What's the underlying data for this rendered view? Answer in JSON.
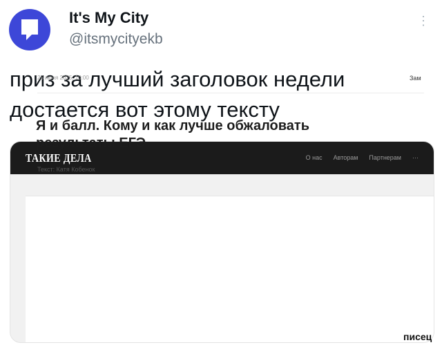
{
  "account": {
    "name": "It's My City",
    "handle": "@itsmycityekb"
  },
  "tweet": {
    "text": "приз за лучший заголовок недели\nдостается вот этому тексту"
  },
  "media": {
    "site_logo": "ТАКИЕ ДЕЛА",
    "nav": [
      "О нас",
      "Авторам",
      "Партнерам",
      "···"
    ],
    "date": "25 июня 2025, 10:00",
    "more_label": "Зам",
    "headline": "Я и балл. Кому и как лучше обжаловать\nрезультаты ЕГЭ",
    "author": "Текст: Катя Кобенок"
  },
  "watermark": "писец",
  "colors": {
    "avatar": "#3d47d8",
    "site_header": "#1b1b1b",
    "handle": "#66717c"
  },
  "icons": {
    "avatar": "speech-bubble-logo-icon",
    "more": "more-vertical-icon"
  }
}
